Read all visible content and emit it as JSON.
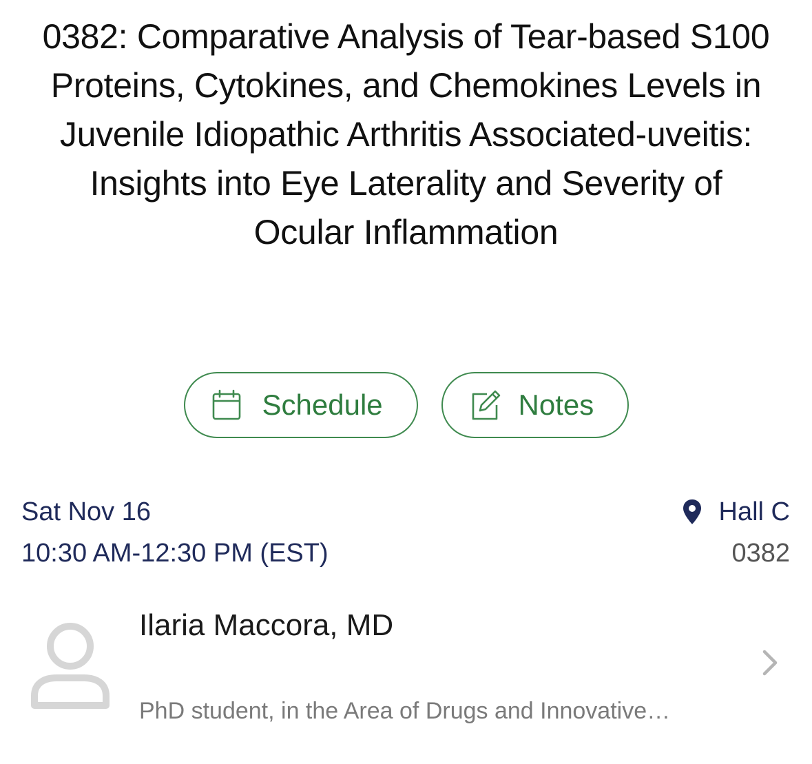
{
  "session": {
    "title": "0382: Comparative Analysis of Tear-based S100 Proteins, Cytokines, and Chemokines Levels in Juvenile Idiopathic Arthritis Associated-uveitis: Insights into Eye Laterality and Severity of Ocular Inflammation",
    "date": "Sat Nov 16",
    "time": "10:30 AM-12:30 PM (EST)",
    "location": "Hall C",
    "code": "0382"
  },
  "actions": {
    "schedule_label": "Schedule",
    "notes_label": "Notes",
    "schedule_icon": "calendar-icon",
    "notes_icon": "edit-note-icon"
  },
  "speaker": {
    "name": "Ilaria Maccora, MD",
    "description": "PhD student, in the Area of Drugs and Innovative…",
    "avatar_icon": "person-placeholder-icon"
  },
  "colors": {
    "accent_green": "#2f7d3f",
    "navy_text": "#1f2a5a",
    "muted_text": "#7a7a7a"
  }
}
